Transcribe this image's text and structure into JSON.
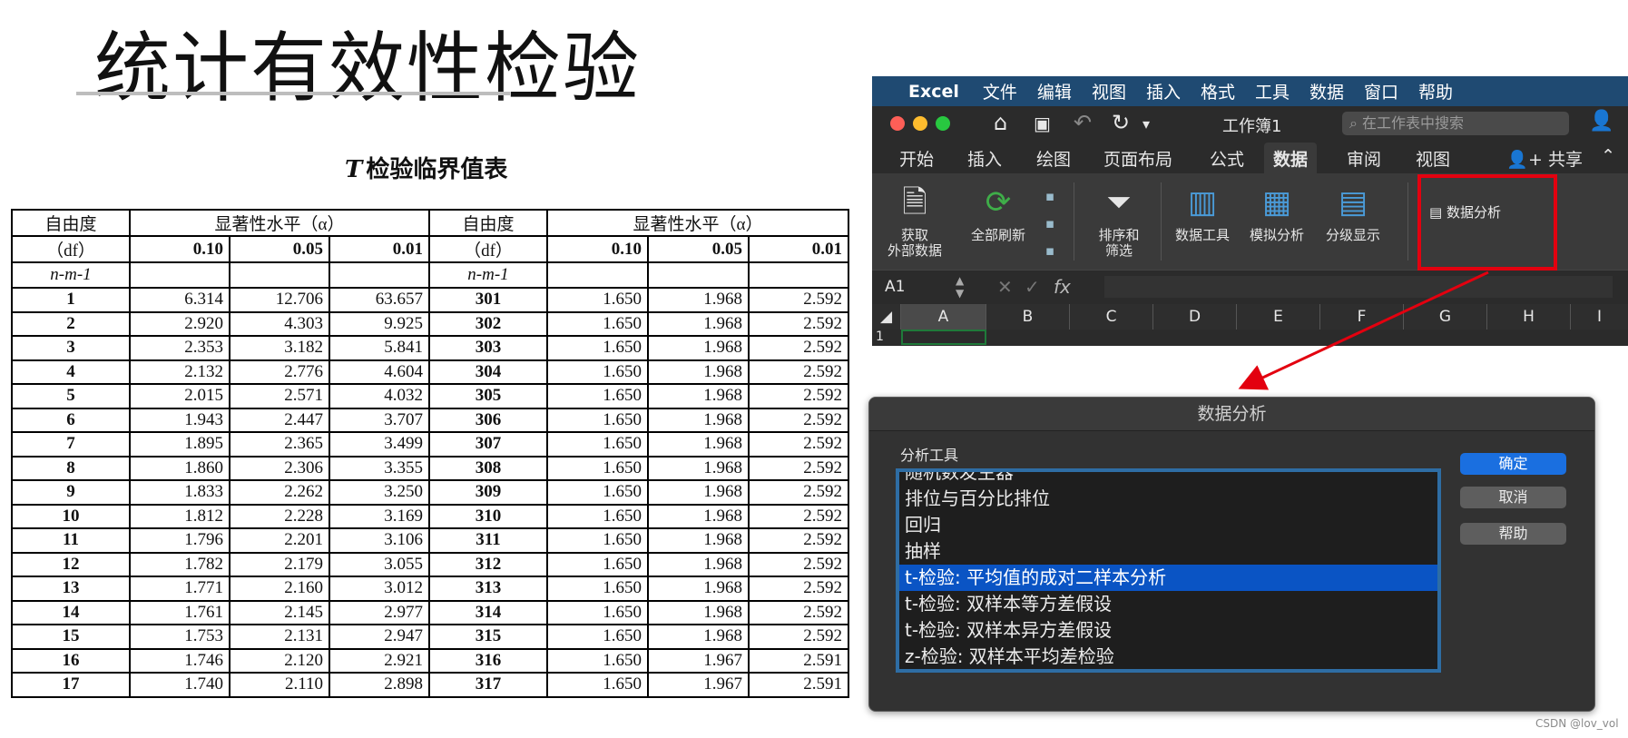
{
  "slide": {
    "title": "统计有效性检验",
    "table_caption_t": "T",
    "table_caption_rest": "检验临界值表"
  },
  "ttable": {
    "header1": {
      "df_label": "自由度",
      "sig_label": "显著性水平（α）"
    },
    "header2": {
      "df_sub": "（df）",
      "levels": [
        "0.10",
        "0.05",
        "0.01"
      ]
    },
    "header3": {
      "nm": "n-m-1"
    },
    "rows": [
      [
        "1",
        "6.314",
        "12.706",
        "63.657",
        "301",
        "1.650",
        "1.968",
        "2.592"
      ],
      [
        "2",
        "2.920",
        "4.303",
        "9.925",
        "302",
        "1.650",
        "1.968",
        "2.592"
      ],
      [
        "3",
        "2.353",
        "3.182",
        "5.841",
        "303",
        "1.650",
        "1.968",
        "2.592"
      ],
      [
        "4",
        "2.132",
        "2.776",
        "4.604",
        "304",
        "1.650",
        "1.968",
        "2.592"
      ],
      [
        "5",
        "2.015",
        "2.571",
        "4.032",
        "305",
        "1.650",
        "1.968",
        "2.592"
      ],
      [
        "6",
        "1.943",
        "2.447",
        "3.707",
        "306",
        "1.650",
        "1.968",
        "2.592"
      ],
      [
        "7",
        "1.895",
        "2.365",
        "3.499",
        "307",
        "1.650",
        "1.968",
        "2.592"
      ],
      [
        "8",
        "1.860",
        "2.306",
        "3.355",
        "308",
        "1.650",
        "1.968",
        "2.592"
      ],
      [
        "9",
        "1.833",
        "2.262",
        "3.250",
        "309",
        "1.650",
        "1.968",
        "2.592"
      ],
      [
        "10",
        "1.812",
        "2.228",
        "3.169",
        "310",
        "1.650",
        "1.968",
        "2.592"
      ],
      [
        "11",
        "1.796",
        "2.201",
        "3.106",
        "311",
        "1.650",
        "1.968",
        "2.592"
      ],
      [
        "12",
        "1.782",
        "2.179",
        "3.055",
        "312",
        "1.650",
        "1.968",
        "2.592"
      ],
      [
        "13",
        "1.771",
        "2.160",
        "3.012",
        "313",
        "1.650",
        "1.968",
        "2.592"
      ],
      [
        "14",
        "1.761",
        "2.145",
        "2.977",
        "314",
        "1.650",
        "1.968",
        "2.592"
      ],
      [
        "15",
        "1.753",
        "2.131",
        "2.947",
        "315",
        "1.650",
        "1.968",
        "2.592"
      ],
      [
        "16",
        "1.746",
        "2.120",
        "2.921",
        "316",
        "1.650",
        "1.967",
        "2.591"
      ],
      [
        "17",
        "1.740",
        "2.110",
        "2.898",
        "317",
        "1.650",
        "1.967",
        "2.591"
      ]
    ]
  },
  "menubar": {
    "apple": "",
    "app": "Excel",
    "items": [
      "文件",
      "编辑",
      "视图",
      "插入",
      "格式",
      "工具",
      "数据",
      "窗口",
      "帮助"
    ]
  },
  "excel": {
    "doc_title": "工作簿1",
    "search_placeholder": "在工作表中搜索",
    "tabs": [
      "开始",
      "插入",
      "绘图",
      "页面布局",
      "公式",
      "数据",
      "审阅",
      "视图"
    ],
    "active_tab": "数据",
    "share": "共享",
    "ribbon": {
      "get_data": [
        "获取",
        "外部数据"
      ],
      "refresh_all": "全部刷新",
      "sort_filter": [
        "排序和",
        "筛选"
      ],
      "data_tools": "数据工具",
      "what_if": "模拟分析",
      "outline": "分级显示",
      "data_analysis": "数据分析"
    },
    "name_box": "A1",
    "fx": "fx",
    "columns": [
      "A",
      "B",
      "C",
      "D",
      "E",
      "F",
      "G",
      "H",
      "I"
    ],
    "row1": "1"
  },
  "dialog": {
    "title": "数据分析",
    "label": "分析工具",
    "items": [
      "随机数发生器",
      "排位与百分比排位",
      "回归",
      "抽样",
      "t-检验: 平均值的成对二样本分析",
      "t-检验: 双样本等方差假设",
      "t-检验: 双样本异方差假设",
      "z-检验: 双样本平均差检验"
    ],
    "selected_index": 4,
    "buttons": {
      "ok": "确定",
      "cancel": "取消",
      "help": "帮助"
    }
  },
  "watermark": "CSDN @lov_vol",
  "colors": {
    "menubar": "#1f4a72",
    "selection": "#0a54c4",
    "primary_button": "#1a6fe0",
    "highlight": "#e3000f"
  }
}
